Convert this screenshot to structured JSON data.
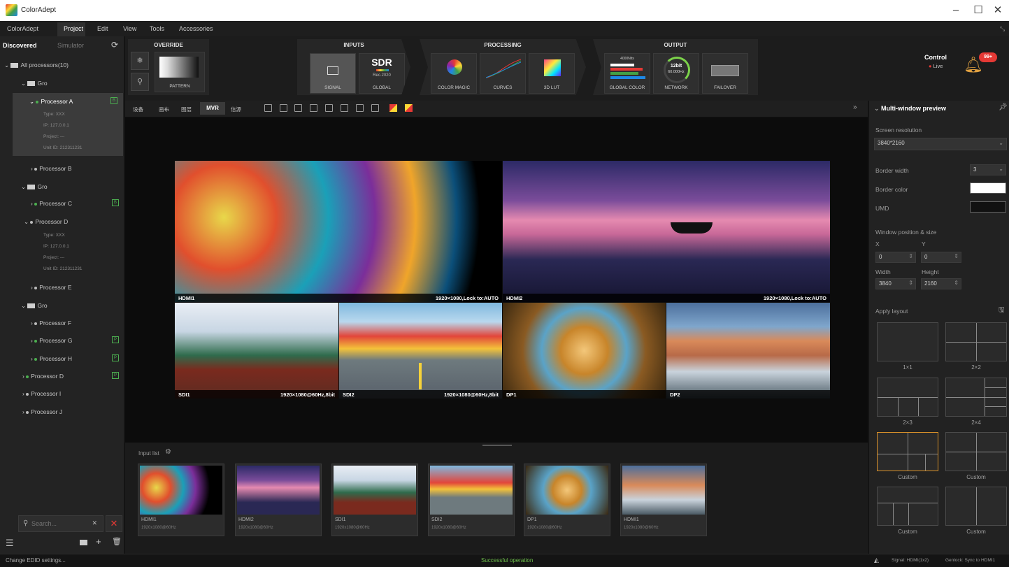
{
  "app": {
    "title": "ColorAdept"
  },
  "menu": [
    "ColorAdept",
    "Project",
    "Edit",
    "View",
    "Tools",
    "Accessories"
  ],
  "left": {
    "tabs": [
      "Discovered",
      "Simulator"
    ],
    "root": "All processors(10)",
    "items": [
      {
        "label": "Gro",
        "sub": "..."
      },
      {
        "label": "Processor A",
        "type": "Type: XXX",
        "ip": "IP: 127.0.0.1",
        "project": "Project: ---",
        "unit": "Unit ID: 212311231",
        "badge": "B"
      },
      {
        "label": "Processor B"
      },
      {
        "label": "Gro"
      },
      {
        "label": "Processor C",
        "badge": "B"
      },
      {
        "label": "Processor D",
        "type": "Type: XXX",
        "ip": "IP: 127.0.0.1",
        "project": "Project: ---",
        "unit": "Unit ID: 212311231"
      },
      {
        "label": "Processor E"
      },
      {
        "label": "Gro"
      },
      {
        "label": "Processor F"
      },
      {
        "label": "Processor G",
        "badge": "P"
      },
      {
        "label": "Processor H",
        "badge": "P"
      },
      {
        "label": "Processor D",
        "badge": "P"
      },
      {
        "label": "Processor I"
      },
      {
        "label": "Processor J"
      }
    ],
    "search_placeholder": "Search..."
  },
  "toolbar": {
    "override": "OVERRIDE",
    "pattern": "PATTERN",
    "inputs": "INPUTS",
    "signal": "SIGNAL",
    "sdr": "SDR",
    "rec": "Rec.2020",
    "global": "GLOBAL",
    "processing": "PROCESSING",
    "color_magic": "COLOR MAGIC",
    "curves": "CURVES",
    "lut": "3D LUT",
    "output": "OUTPUT",
    "nits": "4000Nits",
    "global_color": "GLOBAL COLOR",
    "bit": "12bit",
    "hz": "60.000Hz",
    "network": "NETWORK",
    "failover": "FAILOVER",
    "control": "Control",
    "live": "Live",
    "notif": "99+"
  },
  "subbar": [
    "设备",
    "画布",
    "图层",
    "MVR",
    "信源"
  ],
  "windows": [
    {
      "name": "HDMI1",
      "info": "1920×1080,Lock to:AUTO"
    },
    {
      "name": "HDMI2",
      "info": "1920×1080,Lock to:AUTO"
    },
    {
      "name": "SDI1",
      "info": "1920×1080@60Hz,8bit"
    },
    {
      "name": "SDI2",
      "info": "1920×1080@60Hz,8bit"
    },
    {
      "name": "DP1",
      "info": ""
    },
    {
      "name": "DP2",
      "info": ""
    }
  ],
  "input_list": {
    "title": "Input list",
    "items": [
      {
        "name": "HDMI1",
        "spec": "1920x1080@60Hz"
      },
      {
        "name": "HDMI2",
        "spec": "1920x1080@60Hz"
      },
      {
        "name": "SDI1",
        "spec": "1920x1080@60Hz"
      },
      {
        "name": "SDI2",
        "spec": "1920x1080@60Hz"
      },
      {
        "name": "DP1",
        "spec": "1920x1080@60Hz"
      },
      {
        "name": "HDMI1",
        "spec": "1920x1080@60Hz"
      }
    ]
  },
  "right": {
    "title": "Multi-window preview",
    "screen_res_label": "Screen resolution",
    "screen_res": "3840*2160",
    "border_width_label": "Border width",
    "border_width": "3",
    "border_color_label": "Border color",
    "umd_label": "UMD",
    "winpos_label": "Window position & size",
    "x_label": "X",
    "y_label": "Y",
    "x": "0",
    "y": "0",
    "width_label": "Width",
    "height_label": "Height",
    "width": "3840",
    "height": "2160",
    "apply_layout": "Apply layout",
    "layouts": [
      "1×1",
      "2×2",
      "2×3",
      "2×4",
      "Custom",
      "Custom",
      "Custom",
      "Custom"
    ]
  },
  "status": {
    "left": "Change EDID settings...",
    "center": "Successful operation",
    "signal": "Signal: HDMI(1x2)",
    "genlock": "Genlock: Sync to HDMI1"
  },
  "colors": {
    "accent_green": "#4caf50",
    "status_green": "#6dbf4b",
    "alert_red": "#e53935",
    "selected_layout": "#d7902a"
  }
}
